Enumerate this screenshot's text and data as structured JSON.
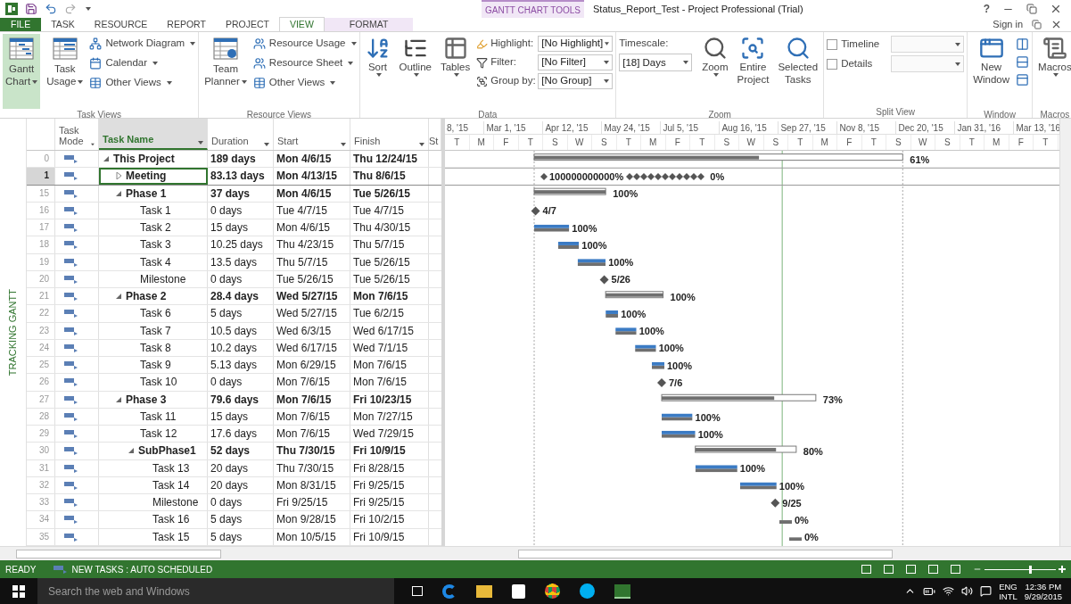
{
  "title_bar": {
    "context_group": "GANTT CHART TOOLS",
    "title": "Status_Report_Test - Project Professional (Trial)",
    "help": "?"
  },
  "tabs": [
    {
      "label": "FILE",
      "kind": "file",
      "selected": false
    },
    {
      "label": "TASK",
      "kind": "normal",
      "selected": false
    },
    {
      "label": "RESOURCE",
      "kind": "normal",
      "selected": false
    },
    {
      "label": "REPORT",
      "kind": "normal",
      "selected": false
    },
    {
      "label": "PROJECT",
      "kind": "normal",
      "selected": false
    },
    {
      "label": "VIEW",
      "kind": "normal",
      "selected": true
    },
    {
      "label": "FORMAT",
      "kind": "context",
      "selected": false
    }
  ],
  "sign_in": "Sign in",
  "ribbon": [
    {
      "label": "Task Views",
      "items": [
        {
          "kind": "large",
          "lines": [
            "Gantt",
            "Chart"
          ],
          "dropdown": true,
          "selected": true
        },
        {
          "kind": "large",
          "lines": [
            "Task",
            "Usage"
          ],
          "dropdown": true,
          "selected": false
        },
        {
          "kind": "stack",
          "items": [
            {
              "label": "Network Diagram",
              "dropdown": true
            },
            {
              "label": "Calendar",
              "dropdown": true
            },
            {
              "label": "Other Views",
              "dropdown": true
            }
          ]
        }
      ]
    },
    {
      "label": "Resource Views",
      "items": [
        {
          "kind": "large",
          "lines": [
            "Team",
            "Planner"
          ],
          "dropdown": true,
          "selected": false
        },
        {
          "kind": "stack",
          "items": [
            {
              "label": "Resource Usage",
              "dropdown": true
            },
            {
              "label": "Resource Sheet",
              "dropdown": true
            },
            {
              "label": "Other Views",
              "dropdown": true
            }
          ]
        }
      ]
    },
    {
      "label": "Data",
      "items": [
        {
          "kind": "large",
          "lines": [
            "Sort"
          ],
          "dropdown": true,
          "selected": false
        },
        {
          "kind": "large",
          "lines": [
            "Outline"
          ],
          "dropdown": true,
          "selected": false
        },
        {
          "kind": "large",
          "lines": [
            "Tables"
          ],
          "dropdown": true,
          "selected": false
        },
        {
          "kind": "fields",
          "items": [
            {
              "label": "Highlight:",
              "value": "[No Highlight]"
            },
            {
              "label": "Filter:",
              "value": "[No Filter]"
            },
            {
              "label": "Group by:",
              "value": "[No Group]"
            }
          ]
        }
      ]
    },
    {
      "label": "Zoom",
      "items": [
        {
          "kind": "field-above",
          "label": "Timescale:",
          "value": "[18] Days"
        },
        {
          "kind": "large",
          "lines": [
            "Zoom"
          ],
          "dropdown": true,
          "selected": false
        },
        {
          "kind": "large",
          "lines": [
            "Entire",
            "Project"
          ],
          "dropdown": false,
          "selected": false
        },
        {
          "kind": "large",
          "lines": [
            "Selected",
            "Tasks"
          ],
          "dropdown": false,
          "selected": false
        }
      ]
    },
    {
      "label": "Split View",
      "items": [
        {
          "kind": "checks",
          "items": [
            {
              "label": "Timeline",
              "checked": false
            },
            {
              "label": "Details",
              "checked": false
            }
          ]
        }
      ]
    },
    {
      "label": "Window",
      "items": [
        {
          "kind": "large",
          "lines": [
            "New",
            "Window"
          ],
          "dropdown": false,
          "selected": false
        },
        {
          "kind": "icon-stack"
        }
      ]
    },
    {
      "label": "Macros",
      "items": [
        {
          "kind": "large",
          "lines": [
            "Macros"
          ],
          "dropdown": true,
          "selected": false
        }
      ]
    }
  ],
  "view_label": "TRACKING GANTT",
  "table": {
    "columns": [
      {
        "label": "Task Mode",
        "selected": false
      },
      {
        "label": "Task Name",
        "selected": true
      },
      {
        "label": "Duration",
        "selected": false
      },
      {
        "label": "Start",
        "selected": false
      },
      {
        "label": "Finish",
        "selected": false
      },
      {
        "label": "St",
        "selected": false
      }
    ],
    "rows": [
      {
        "id": "0",
        "name": "This Project",
        "duration": "189 days",
        "start": "Mon 4/6/15",
        "finish": "Thu 12/24/15",
        "expanded": true,
        "selected": false,
        "bar": {
          "kind": "summary",
          "label": "61%",
          "level": 0.61
        },
        "children": [
          {
            "id": "1",
            "name": "Meeting",
            "duration": "83.13 days",
            "start": "Mon 4/13/15",
            "finish": "Thu 8/6/15",
            "expanded": false,
            "selected": true,
            "bar": {
              "kind": "recurring",
              "overlap_label": "100000000000%",
              "label": "0%"
            }
          },
          {
            "id": "15",
            "name": "Phase 1",
            "duration": "37 days",
            "start": "Mon 4/6/15",
            "finish": "Tue 5/26/15",
            "expanded": true,
            "selected": false,
            "bar": {
              "kind": "summary",
              "label": "100%",
              "level": 1
            },
            "children": [
              {
                "id": "16",
                "name": "Task 1",
                "duration": "0 days",
                "start": "Tue 4/7/15",
                "finish": "Tue 4/7/15",
                "selected": false,
                "bar": {
                  "kind": "milestone",
                  "label": "4/7"
                }
              },
              {
                "id": "17",
                "name": "Task 2",
                "duration": "15 days",
                "start": "Mon 4/6/15",
                "finish": "Thu 4/30/15",
                "selected": false,
                "bar": {
                  "kind": "task",
                  "label": "100%",
                  "level": 1
                }
              },
              {
                "id": "18",
                "name": "Task 3",
                "duration": "10.25 days",
                "start": "Thu 4/23/15",
                "finish": "Thu 5/7/15",
                "selected": false,
                "bar": {
                  "kind": "task",
                  "label": "100%",
                  "level": 1
                }
              },
              {
                "id": "19",
                "name": "Task 4",
                "duration": "13.5 days",
                "start": "Thu 5/7/15",
                "finish": "Tue 5/26/15",
                "selected": false,
                "bar": {
                  "kind": "task",
                  "label": "100%",
                  "level": 1
                }
              },
              {
                "id": "20",
                "name": "Milestone",
                "duration": "0 days",
                "start": "Tue 5/26/15",
                "finish": "Tue 5/26/15",
                "selected": false,
                "bar": {
                  "kind": "milestone",
                  "label": "5/26"
                }
              }
            ]
          },
          {
            "id": "21",
            "name": "Phase 2",
            "duration": "28.4 days",
            "start": "Wed 5/27/15",
            "finish": "Mon 7/6/15",
            "expanded": true,
            "selected": false,
            "bar": {
              "kind": "summary",
              "label": "100%",
              "level": 1
            },
            "children": [
              {
                "id": "22",
                "name": "Task 6",
                "duration": "5 days",
                "start": "Wed 5/27/15",
                "finish": "Tue 6/2/15",
                "selected": false,
                "bar": {
                  "kind": "task",
                  "label": "100%",
                  "level": 1
                }
              },
              {
                "id": "23",
                "name": "Task 7",
                "duration": "10.5 days",
                "start": "Wed 6/3/15",
                "finish": "Wed 6/17/15",
                "selected": false,
                "bar": {
                  "kind": "task",
                  "label": "100%",
                  "level": 1
                }
              },
              {
                "id": "24",
                "name": "Task 8",
                "duration": "10.2 days",
                "start": "Wed 6/17/15",
                "finish": "Wed 7/1/15",
                "selected": false,
                "bar": {
                  "kind": "task",
                  "label": "100%",
                  "level": 1
                }
              },
              {
                "id": "25",
                "name": "Task 9",
                "duration": "5.13 days",
                "start": "Mon 6/29/15",
                "finish": "Mon 7/6/15",
                "selected": false,
                "bar": {
                  "kind": "task",
                  "label": "100%",
                  "level": 1
                }
              },
              {
                "id": "26",
                "name": "Task 10",
                "duration": "0 days",
                "start": "Mon 7/6/15",
                "finish": "Mon 7/6/15",
                "selected": false,
                "bar": {
                  "kind": "milestone",
                  "label": "7/6"
                }
              }
            ]
          },
          {
            "id": "27",
            "name": "Phase 3",
            "duration": "79.6 days",
            "start": "Mon 7/6/15",
            "finish": "Fri 10/23/15",
            "expanded": true,
            "selected": false,
            "bar": {
              "kind": "summary",
              "label": "73%",
              "level": 0.73
            },
            "children": [
              {
                "id": "28",
                "name": "Task 11",
                "duration": "15 days",
                "start": "Mon 7/6/15",
                "finish": "Mon 7/27/15",
                "selected": false,
                "bar": {
                  "kind": "task",
                  "label": "100%",
                  "level": 1
                }
              },
              {
                "id": "29",
                "name": "Task 12",
                "duration": "17.6 days",
                "start": "Mon 7/6/15",
                "finish": "Wed 7/29/15",
                "selected": false,
                "bar": {
                  "kind": "task",
                  "label": "100%",
                  "level": 1
                }
              },
              {
                "id": "30",
                "name": "SubPhase1",
                "duration": "52 days",
                "start": "Thu 7/30/15",
                "finish": "Fri 10/9/15",
                "expanded": true,
                "selected": false,
                "bar": {
                  "kind": "summary",
                  "label": "80%",
                  "level": 0.8
                },
                "children": [
                  {
                    "id": "31",
                    "name": "Task 13",
                    "duration": "20 days",
                    "start": "Thu 7/30/15",
                    "finish": "Fri 8/28/15",
                    "selected": false,
                    "bar": {
                      "kind": "task",
                      "label": "100%",
                      "level": 1
                    }
                  },
                  {
                    "id": "32",
                    "name": "Task 14",
                    "duration": "20 days",
                    "start": "Mon 8/31/15",
                    "finish": "Fri 9/25/15",
                    "selected": false,
                    "bar": {
                      "kind": "task",
                      "label": "100%",
                      "level": 1
                    }
                  },
                  {
                    "id": "33",
                    "name": "Milestone",
                    "duration": "0 days",
                    "start": "Fri 9/25/15",
                    "finish": "Fri 9/25/15",
                    "selected": false,
                    "bar": {
                      "kind": "milestone",
                      "label": "9/25"
                    }
                  },
                  {
                    "id": "34",
                    "name": "Task 16",
                    "duration": "5 days",
                    "start": "Mon 9/28/15",
                    "finish": "Fri 10/2/15",
                    "selected": false,
                    "bar": {
                      "kind": "task",
                      "label": "0%"
                    }
                  },
                  {
                    "id": "35",
                    "name": "Task 15",
                    "duration": "5 days",
                    "start": "Mon 10/5/15",
                    "finish": "Fri 10/9/15",
                    "selected": false,
                    "bar": {
                      "kind": "task",
                      "label": "0%"
                    }
                  }
                ]
              }
            ]
          }
        ]
      }
    ]
  },
  "timescale": {
    "major": [
      "8, '15",
      "Mar 1, '15",
      "Apr 12, '15",
      "May 24, '15",
      "Jul 5, '15",
      "Aug 16, '15",
      "Sep 27, '15",
      "Nov 8, '15",
      "Dec 20, '15",
      "Jan 31, '16",
      "Mar 13, '16"
    ],
    "minor": [
      "T",
      "M",
      "F",
      "T",
      "S",
      "W",
      "S",
      "T",
      "M",
      "F",
      "T",
      "S",
      "W",
      "S",
      "T",
      "M",
      "F",
      "T",
      "S",
      "W",
      "S",
      "T",
      "M",
      "F",
      "T"
    ]
  },
  "status_bar": {
    "mode": "READY",
    "new_tasks": "NEW TASKS : AUTO SCHEDULED",
    "level": 0.63
  },
  "taskbar": {
    "search_placeholder": "Search the web and Windows",
    "language": "ENG",
    "layout": "INTL",
    "time": "12:36 PM",
    "date": "9/29/2015"
  }
}
